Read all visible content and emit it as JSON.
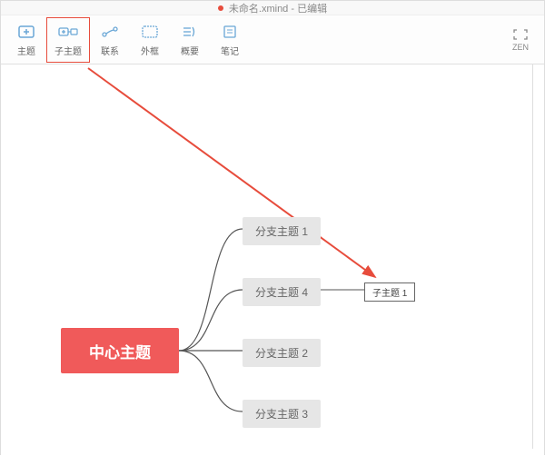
{
  "title": "未命名.xmind - 已编辑",
  "toolbar": {
    "items": [
      {
        "label": "主题",
        "icon": "plus-box-icon"
      },
      {
        "label": "子主题",
        "icon": "plus-box-icon"
      },
      {
        "label": "联系",
        "icon": "link-icon"
      },
      {
        "label": "外框",
        "icon": "frame-icon"
      },
      {
        "label": "概要",
        "icon": "summary-icon"
      },
      {
        "label": "笔记",
        "icon": "notes-icon"
      }
    ],
    "zen_label": "ZEN"
  },
  "mindmap": {
    "central": "中心主题",
    "branches": [
      "分支主题 1",
      "分支主题 4",
      "分支主题 2",
      "分支主题 3"
    ],
    "subtopic": "子主题 1"
  },
  "annotation": {
    "highlight_tool_index": 1
  }
}
